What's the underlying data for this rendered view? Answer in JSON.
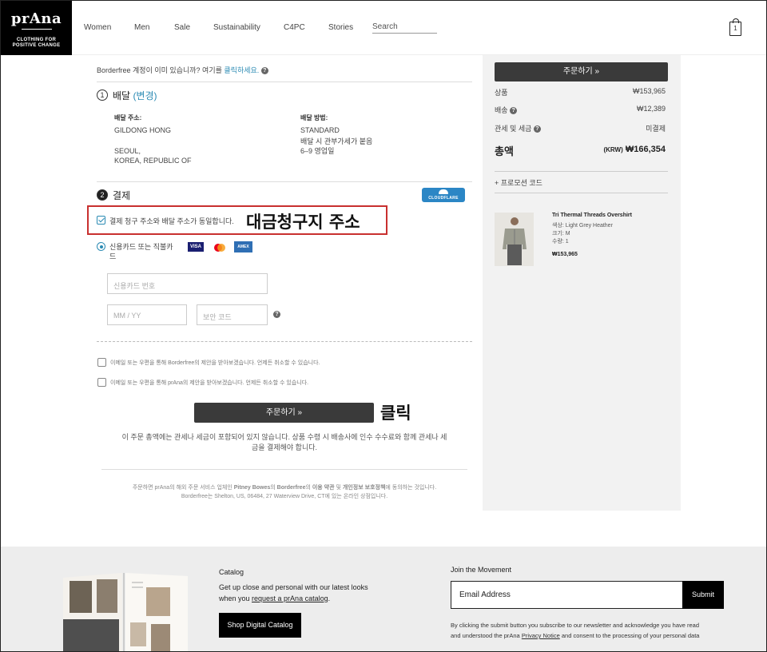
{
  "header": {
    "logo_brand": "prAna",
    "logo_tag_line1": "CLOTHING FOR",
    "logo_tag_line2": "POSITIVE CHANGE",
    "nav": [
      "Women",
      "Men",
      "Sale",
      "Sustainability",
      "C4PC",
      "Stories"
    ],
    "search_placeholder": "Search",
    "cart_count": "1"
  },
  "account_prompt": {
    "text": "Borderfree 계정이 이미 있습니까? 여기를 ",
    "link": "클릭하세요.",
    "help": "?"
  },
  "delivery": {
    "step": "1",
    "title": "배달",
    "change_link": "(변경)",
    "address_label": "배달 주소:",
    "address_name": "GILDONG HONG",
    "address_city": "SEOUL,",
    "address_country": "KOREA, REPUBLIC OF",
    "method_label": "배달 방법:",
    "method_name": "STANDARD",
    "method_note": "배달 시 관부가세가 붙음",
    "method_days": "6–9 영업일"
  },
  "payment": {
    "step": "2",
    "title": "결제",
    "cloudflare_badge": "CLOUDFLARE",
    "same_address_label": "결제 청구 주소와 배달 주소가 동일합니다.",
    "card_option_line1": "신용카드 또는 직불카",
    "card_option_line2": "드",
    "card_brands": [
      "VISA",
      "MC",
      "AMEX"
    ],
    "card_number_placeholder": "신용카드 번호",
    "expiry_placeholder": "MM / YY",
    "cvv_placeholder": "보안 코드",
    "help": "?"
  },
  "opt_ins": [
    "이메일 또는 우편을 통해 Borderfree의 제안을 받아보겠습니다. 언제든 취소할 수 있습니다.",
    "이메일 또는 우편을 통해 prAna의 제안을 받아보겠습니다. 언제든 취소할 수 있습니다."
  ],
  "place_order": {
    "label": "주문하기 »",
    "note_line1": "이 주문 총액에는 관세나 세금이 포함되어 있지 않습니다. 상품 수령 시 배송사에 인수 수수료와 함께 관세나 세",
    "note_line2": "금을 결제해야 합니다."
  },
  "legal": {
    "line1_a": "주문하면 prAna의 해외 주문 서비스 업체인 ",
    "line1_b": "Pitney Bowes",
    "line1_c": "의 ",
    "line1_d": "Borderfree",
    "line1_e": "의 ",
    "line1_f": "이용 약관",
    "line1_g": " 및 ",
    "line1_h": "개인정보 보호정책",
    "line1_i": "에 동의하는 것입니다.",
    "line2": "Borderfree는 Shelton, US, 06484, 27 Waterview Drive, CT에 있는 온라인 상점입니다."
  },
  "annotations": {
    "billing": "대금청구지 주소",
    "click": "클릭"
  },
  "summary": {
    "order_button": "주문하기 »",
    "items_label": "상품",
    "items_value": "₩153,965",
    "shipping_label": "배송",
    "shipping_value": "₩12,389",
    "tax_label": "관세 및 세금",
    "tax_value": "미결제",
    "total_label": "총액",
    "total_currency": "(KRW)",
    "total_value": "₩166,354",
    "promo": "+ 프로모션 코드",
    "product": {
      "name": "Tri Thermal Threads Overshirt",
      "color": "색상: Light Grey Heather",
      "size": "크기: M",
      "qty": "수량: 1",
      "price": "₩153,965"
    }
  },
  "footer": {
    "catalog_title": "Catalog",
    "catalog_text_line1": "Get up close and personal with our latest looks",
    "catalog_text_line2a": "when you ",
    "catalog_text_link": "request a prAna catalog",
    "catalog_text_line2b": ".",
    "catalog_button": "Shop Digital Catalog",
    "join_title": "Join the Movement",
    "email_placeholder": "Email Address",
    "submit": "Submit",
    "legal_line1": "By clicking the submit button you subscribe to our newsletter and acknowledge you have read",
    "legal_line2a": "and understood the prAna ",
    "legal_link": "Privacy Notice",
    "legal_line2b": " and consent to the processing of your personal data"
  },
  "colors": {
    "accent": "#2a8ab3",
    "highlight_box": "#c8302f",
    "button_dark": "#3a3a3a",
    "sidebar_bg": "#f2f2f2",
    "footer_bg": "#ededed"
  }
}
